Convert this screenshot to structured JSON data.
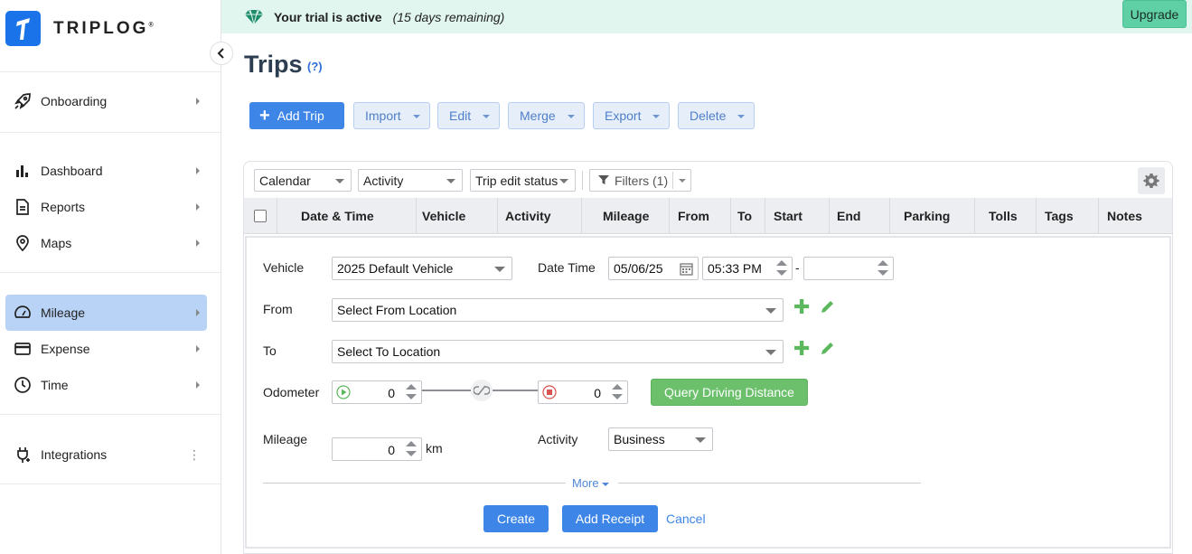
{
  "app": {
    "logo_text": "TRIPLOG",
    "logo_reg": "®"
  },
  "sidebar": {
    "items": [
      {
        "label": "Onboarding",
        "icon": "rocket-icon"
      },
      {
        "label": "Dashboard",
        "icon": "bar-chart-icon"
      },
      {
        "label": "Reports",
        "icon": "document-icon"
      },
      {
        "label": "Maps",
        "icon": "map-pin-icon"
      },
      {
        "label": "Mileage",
        "icon": "speedometer-icon",
        "active": true
      },
      {
        "label": "Expense",
        "icon": "credit-card-icon"
      },
      {
        "label": "Time",
        "icon": "clock-icon"
      },
      {
        "label": "Integrations",
        "icon": "plug-icon"
      }
    ]
  },
  "banner": {
    "title": "Your trial is active",
    "subtitle": "(15 days remaining)",
    "upgrade_label": "Upgrade"
  },
  "page": {
    "title": "Trips",
    "help": "(?)"
  },
  "toolbar": {
    "add_trip": "Add Trip",
    "import": "Import",
    "edit": "Edit",
    "merge": "Merge",
    "export": "Export",
    "delete": "Delete"
  },
  "filters": {
    "calendar": "Calendar",
    "activity": "Activity",
    "trip_edit_status": "Trip edit status",
    "filters": "Filters (1)"
  },
  "table": {
    "columns": [
      "Date & Time",
      "Vehicle",
      "Activity",
      "Mileage",
      "From",
      "To",
      "Start",
      "End",
      "Parking",
      "Tolls",
      "Tags",
      "Notes"
    ]
  },
  "form": {
    "vehicle_label": "Vehicle",
    "vehicle_value": "2025 Default Vehicle",
    "datetime_label": "Date Time",
    "date_value": "05/06/25",
    "time_value": "05:33 PM",
    "time_separator": "-",
    "end_time_value": "",
    "from_label": "From",
    "from_value": "Select From Location",
    "to_label": "To",
    "to_value": "Select To Location",
    "odometer_label": "Odometer",
    "odometer_start": "0",
    "odometer_end": "0",
    "query_button": "Query Driving Distance",
    "mileage_label": "Mileage",
    "mileage_value": "0",
    "mileage_unit": "km",
    "activity_label": "Activity",
    "activity_value": "Business",
    "more_label": "More",
    "create_button": "Create",
    "add_receipt_button": "Add Receipt",
    "cancel_link": "Cancel"
  },
  "colors": {
    "primary": "#3d86e8",
    "banner_bg": "#e1f6ef",
    "upgrade": "#5fd0a6",
    "success": "#6cc06c",
    "active_nav": "#b9d3f7"
  }
}
